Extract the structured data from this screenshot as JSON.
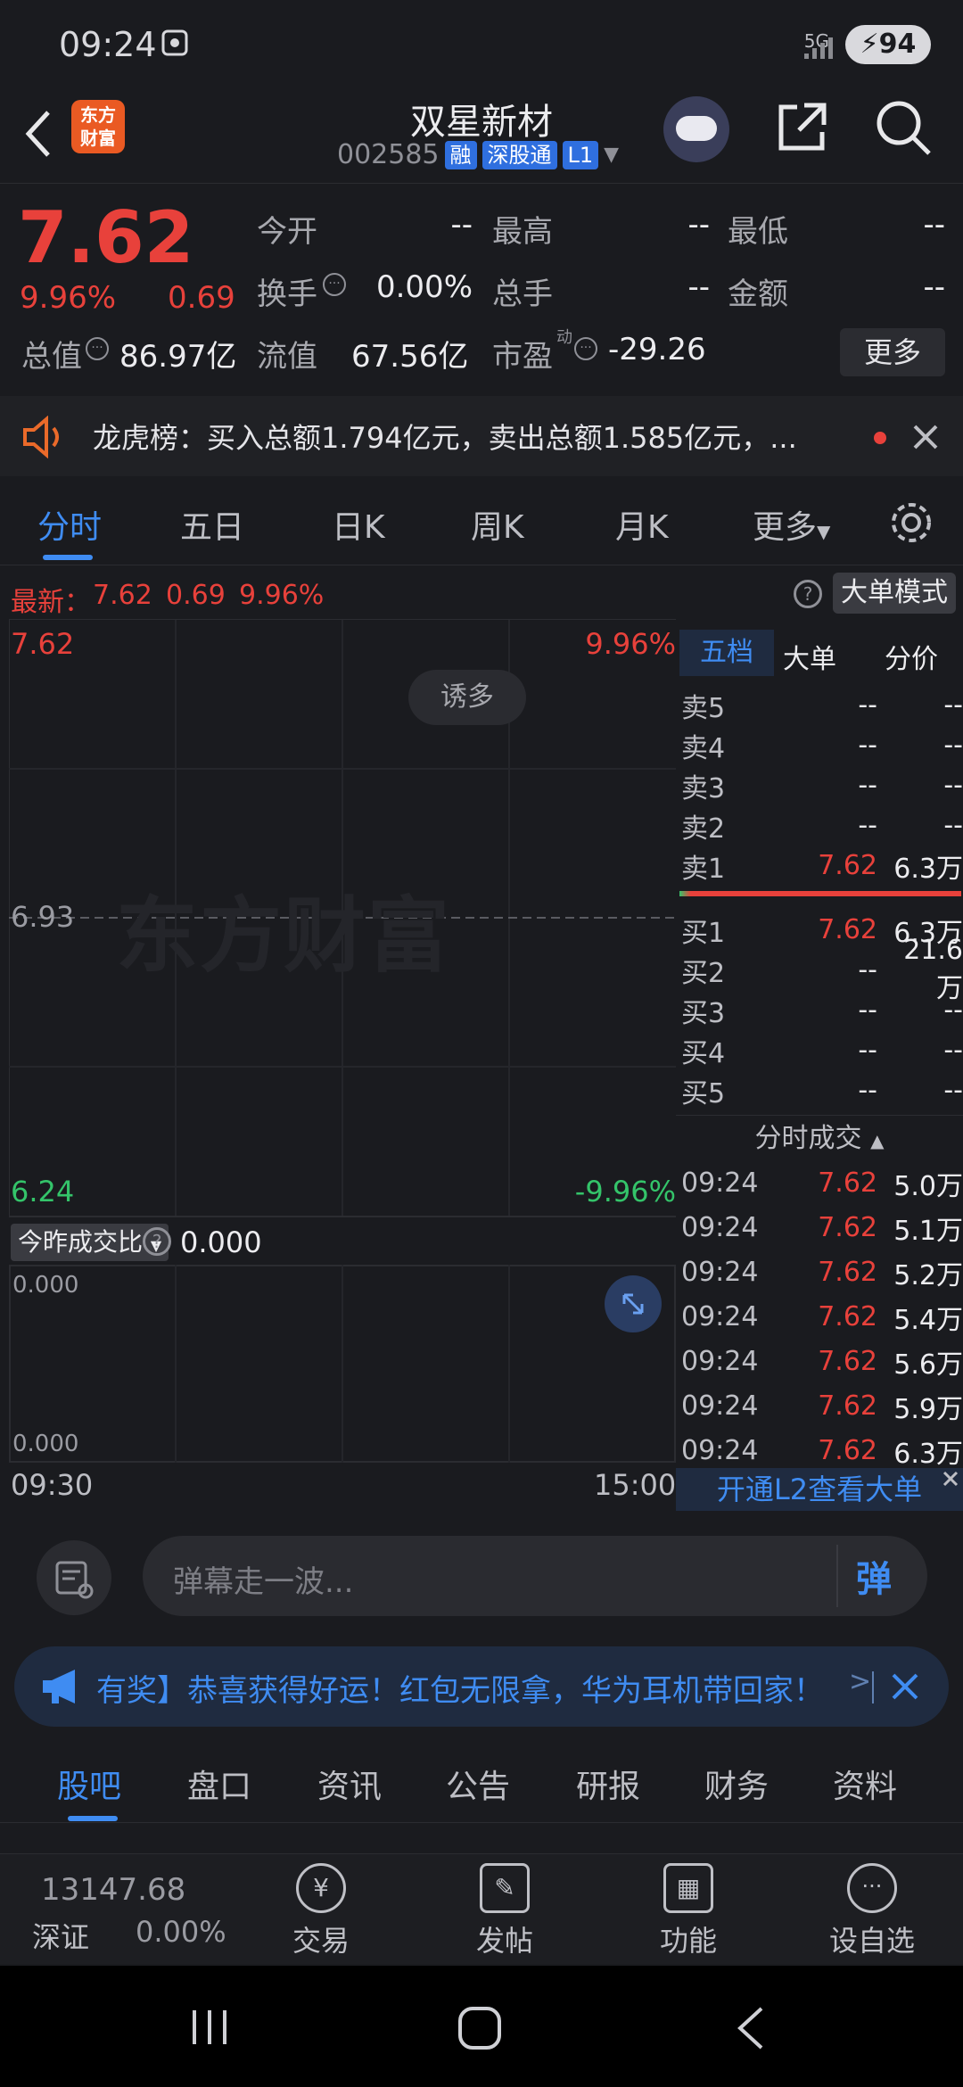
{
  "status_bar": {
    "time": "09:24",
    "network": "5G",
    "battery": "94"
  },
  "header": {
    "title": "双星新材",
    "code": "002585",
    "tags": [
      "融",
      "深股通",
      "L1"
    ],
    "logo_text": "东方\n财富"
  },
  "quote": {
    "price": "7.62",
    "change_pct": "9.96%",
    "change": "0.69",
    "fields": [
      {
        "label": "今开",
        "value": "--"
      },
      {
        "label": "最高",
        "value": "--"
      },
      {
        "label": "最低",
        "value": "--"
      },
      {
        "label": "换手",
        "value": "0.00%"
      },
      {
        "label": "总手",
        "value": "--"
      },
      {
        "label": "金额",
        "value": "--"
      },
      {
        "label": "总值",
        "value": "86.97亿"
      },
      {
        "label": "流值",
        "value": "67.56亿"
      },
      {
        "label": "市盈",
        "value": "-29.26"
      }
    ],
    "pe_superscript": "动",
    "more_label": "更多"
  },
  "banner": {
    "text": "龙虎榜：买入总额1.794亿元，卖出总额1.585亿元，..."
  },
  "tabs": [
    "分时",
    "五日",
    "日K",
    "周K",
    "月K",
    "更多"
  ],
  "latest": {
    "label": "最新：",
    "price": "7.62",
    "change": "0.69",
    "pct": "9.96%",
    "mode_label": "大单模式"
  },
  "chart": {
    "top_price": "7.62",
    "top_pct": "9.96%",
    "mid_price": "6.93",
    "bottom_price": "6.24",
    "bottom_pct": "-9.96%",
    "badge": "诱多",
    "watermark": "东方财富",
    "start_time": "09:30",
    "end_time": "15:00"
  },
  "volume": {
    "selector": "今昨成交比",
    "value": "0.000",
    "top_label": "0.000",
    "bottom_label": "0.000"
  },
  "book": {
    "tabs": [
      "五档",
      "大单",
      "分价"
    ],
    "sells": [
      {
        "label": "卖5",
        "price": "--",
        "vol": "--"
      },
      {
        "label": "卖4",
        "price": "--",
        "vol": "--"
      },
      {
        "label": "卖3",
        "price": "--",
        "vol": "--"
      },
      {
        "label": "卖2",
        "price": "--",
        "vol": "--"
      },
      {
        "label": "卖1",
        "price": "7.62",
        "vol": "6.3万"
      }
    ],
    "buys": [
      {
        "label": "买1",
        "price": "7.62",
        "vol": "6.3万"
      },
      {
        "label": "买2",
        "price": "--",
        "vol": "21.6万"
      },
      {
        "label": "买3",
        "price": "--",
        "vol": "--"
      },
      {
        "label": "买4",
        "price": "--",
        "vol": "--"
      },
      {
        "label": "买5",
        "price": "--",
        "vol": "--"
      }
    ],
    "ticks_header": "分时成交",
    "ticks": [
      {
        "time": "09:24",
        "price": "7.62",
        "vol": "5.0万"
      },
      {
        "time": "09:24",
        "price": "7.62",
        "vol": "5.1万"
      },
      {
        "time": "09:24",
        "price": "7.62",
        "vol": "5.2万"
      },
      {
        "time": "09:24",
        "price": "7.62",
        "vol": "5.4万"
      },
      {
        "time": "09:24",
        "price": "7.62",
        "vol": "5.6万"
      },
      {
        "time": "09:24",
        "price": "7.62",
        "vol": "5.9万"
      },
      {
        "time": "09:24",
        "price": "7.62",
        "vol": "6.3万"
      }
    ],
    "l2_label": "开通L2查看大单"
  },
  "danmu": {
    "placeholder": "弹幕走一波...",
    "send_label": "弹"
  },
  "promo": {
    "text": "有奖】恭喜获得好运！红包无限拿，华为耳机带回家！"
  },
  "footer_tabs": [
    "股吧",
    "盘口",
    "资讯",
    "公告",
    "研报",
    "财务",
    "资料"
  ],
  "navbar": {
    "index_value": "13147.68",
    "index_name": "深证",
    "index_pct": "0.00%",
    "items": [
      "交易",
      "发帖",
      "功能",
      "设自选"
    ]
  },
  "colors": {
    "up": "#e8413b",
    "down": "#34c46a",
    "accent": "#3f8cf2",
    "bg": "#1a1b1f"
  }
}
